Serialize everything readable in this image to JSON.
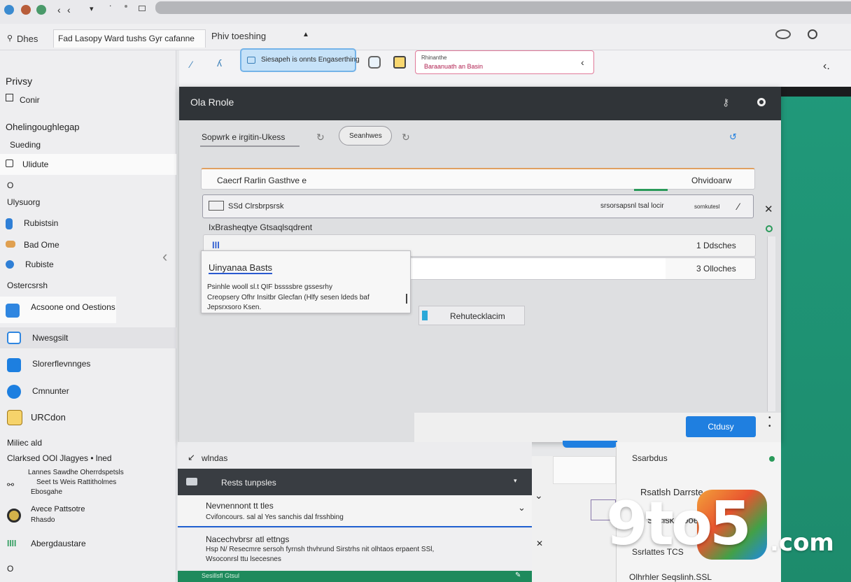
{
  "tabs": {
    "tab_one": "Dhes",
    "tab_two": "Fad Lasopy Ward tushs Gyr cafanne",
    "tab_three": "Phiv toeshing"
  },
  "toolbar": {
    "search_pill_text": "Siesapeh is onnts Engaserthing",
    "url_line1": "Rhinanthe",
    "url_line2": "Baraanuath an Basin"
  },
  "sidebar": {
    "section_privacy": "Privsy",
    "conir": "Conir",
    "group_heading": "Ohelingoughlegap",
    "item_sueding": "Sueding",
    "item_ulidate": "Ulidute",
    "item_o": "O",
    "item_ulysuorg": "Ulysuorg",
    "item_rubistsin": "Rubistsin",
    "item_bad_ome": "Bad Ome",
    "item_rubiste": "Rubiste",
    "section_ostercsrsh": "Ostercsrsh",
    "item_acsoone": "Acsoone ond Oestions",
    "item_nwesgsilt": "Nwesgsilt",
    "item_slorerflevnnges": "Slorerflevnnges",
    "item_cmnunter": "Cmnunter",
    "item_urcdon": "URCdon",
    "section_miliec": "Miliec ald",
    "clarksed": "Clarksed OOl Jlagyes • lned",
    "item_lannes_1": "Lannes Sawdhe Oherrdspetsls",
    "item_lannes_2": "Seet ts Weis Rattitholmes",
    "item_lannes_3": "Ebosgahe",
    "item_avece_1": "Avece Pattsotre",
    "item_avece_2": "Rhasdo",
    "item_abergdaustare": "Abergdaustare",
    "item_bottom": "O"
  },
  "modal": {
    "title": "Ola Rnole",
    "search_label": "Sopwrk e irgitin-Ukess",
    "search_button": "Seanhwes",
    "row1_left": "Caecrf Rarlin Gasthve e",
    "row1_right": "Ohvidoarw",
    "row2_left": "SSd Clrsbrpsrsk",
    "row2_mid": "srsorsapsnl tsal locir",
    "row2_right": "sornkutesl",
    "subheading": "IxBrasheqtye Gtsaqlsqdrent",
    "row3_left": "lll",
    "row3_right": "1 Ddsches",
    "row4_right": "3 Olloches",
    "popup_title": "Uinyanaa Basts",
    "popup_line1": "Psinhle wooll sl.t QIF bssssbre gssesrhy",
    "popup_line2": "Creopsery Ofhr Insitbr Glecfan (Hlfy sesen ldeds baf",
    "popup_line3": "Jepsrxsoro Ksen.",
    "reference_button": "Rehutecklacim",
    "ok_button": "Ctdusy"
  },
  "bottom": {
    "header_label": "wlndas",
    "dark_bar_label": "Rests tunpsles",
    "list1_title": "Nevnennont tt tles",
    "list1_sub": "Cvifoncours. sal al Yes sanchis dal frsshbing",
    "list2_title": "Nacechvbrsr atl ettngs",
    "list2_sub1": "Hsp N/ Resecmre sersoh fyrnsh thvhrund Sirstrhs nit olhtaos erpaent SSl,",
    "list2_sub2": "Wsoconrsl ttu lsecesnes",
    "green_strip": "Sesillsfl Gtsul",
    "right_item1": "Ssarbdus",
    "right_item2": "Rsatlsh Darrste",
    "right_item3": "Seclsk Cooers",
    "right_item4": "Ssrlattes TCS",
    "right_item5": "Olhrhler Seqslinh.SSL"
  },
  "watermark": {
    "brand_a": "9to5",
    "brand_b": ".com"
  },
  "colors": {
    "accent_blue": "#1f7fe0",
    "modal_header": "#303438",
    "green_panel": "#20997a"
  }
}
